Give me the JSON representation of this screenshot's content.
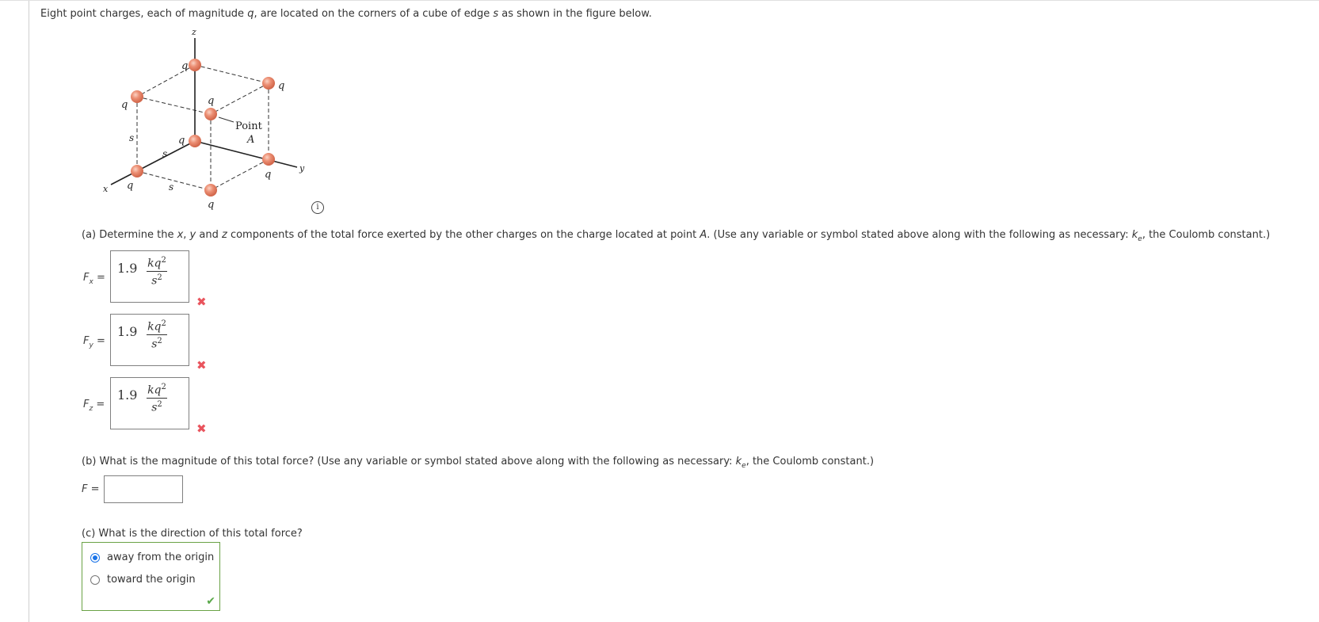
{
  "intro": {
    "text_before_q": "Eight point charges, each of magnitude ",
    "q": "q",
    "text_mid": ", are located on the corners of a cube of edge ",
    "s": "s",
    "text_after": " as shown in the figure below."
  },
  "figure": {
    "axis_labels": {
      "x": "x",
      "y": "y",
      "z": "z"
    },
    "charge_label": "q",
    "edge_label": "s",
    "point_label_line1": "Point",
    "point_label_line2": "A",
    "sphere_color": "#e8836b",
    "info_icon": "i"
  },
  "part_a": {
    "prompt_1": "(a) Determine the ",
    "x": "x",
    "sep1": ", ",
    "y": "y",
    "sep2": " and ",
    "z": "z",
    "prompt_2": " components of the total force exerted by the other charges on the charge located at point ",
    "A": "A",
    "prompt_3": ". (Use any variable or symbol stated above along with the following as necessary: ",
    "k": "k",
    "k_sub": "e",
    "prompt_4": ", the Coulomb constant.)",
    "answers": [
      {
        "label": "F",
        "sub": "x",
        "eq": " =",
        "coef": "1.9",
        "num": "kq",
        "num_exp": "2",
        "den": "s",
        "den_exp": "2",
        "status": "incorrect"
      },
      {
        "label": "F",
        "sub": "y",
        "eq": " =",
        "coef": "1.9",
        "num": "kq",
        "num_exp": "2",
        "den": "s",
        "den_exp": "2",
        "status": "incorrect"
      },
      {
        "label": "F",
        "sub": "z",
        "eq": " =",
        "coef": "1.9",
        "num": "kq",
        "num_exp": "2",
        "den": "s",
        "den_exp": "2",
        "status": "incorrect"
      }
    ],
    "incorrect_mark": "✖"
  },
  "part_b": {
    "prompt_1": "(b) What is the magnitude of this total force? (Use any variable or symbol stated above along with the following as necessary: ",
    "k": "k",
    "k_sub": "e",
    "prompt_2": ", the Coulomb constant.)",
    "label": "F",
    "eq": " =",
    "value": ""
  },
  "part_c": {
    "prompt": "(c) What is the direction of this total force?",
    "options": [
      {
        "label": "away from the origin",
        "selected": true
      },
      {
        "label": "toward the origin",
        "selected": false
      }
    ],
    "correct_mark": "✔"
  },
  "colors": {
    "incorrect": "#e9545d",
    "correct": "#5aa84a",
    "correct_border": "#6aa245",
    "radio_selected": "#1a73e8"
  }
}
